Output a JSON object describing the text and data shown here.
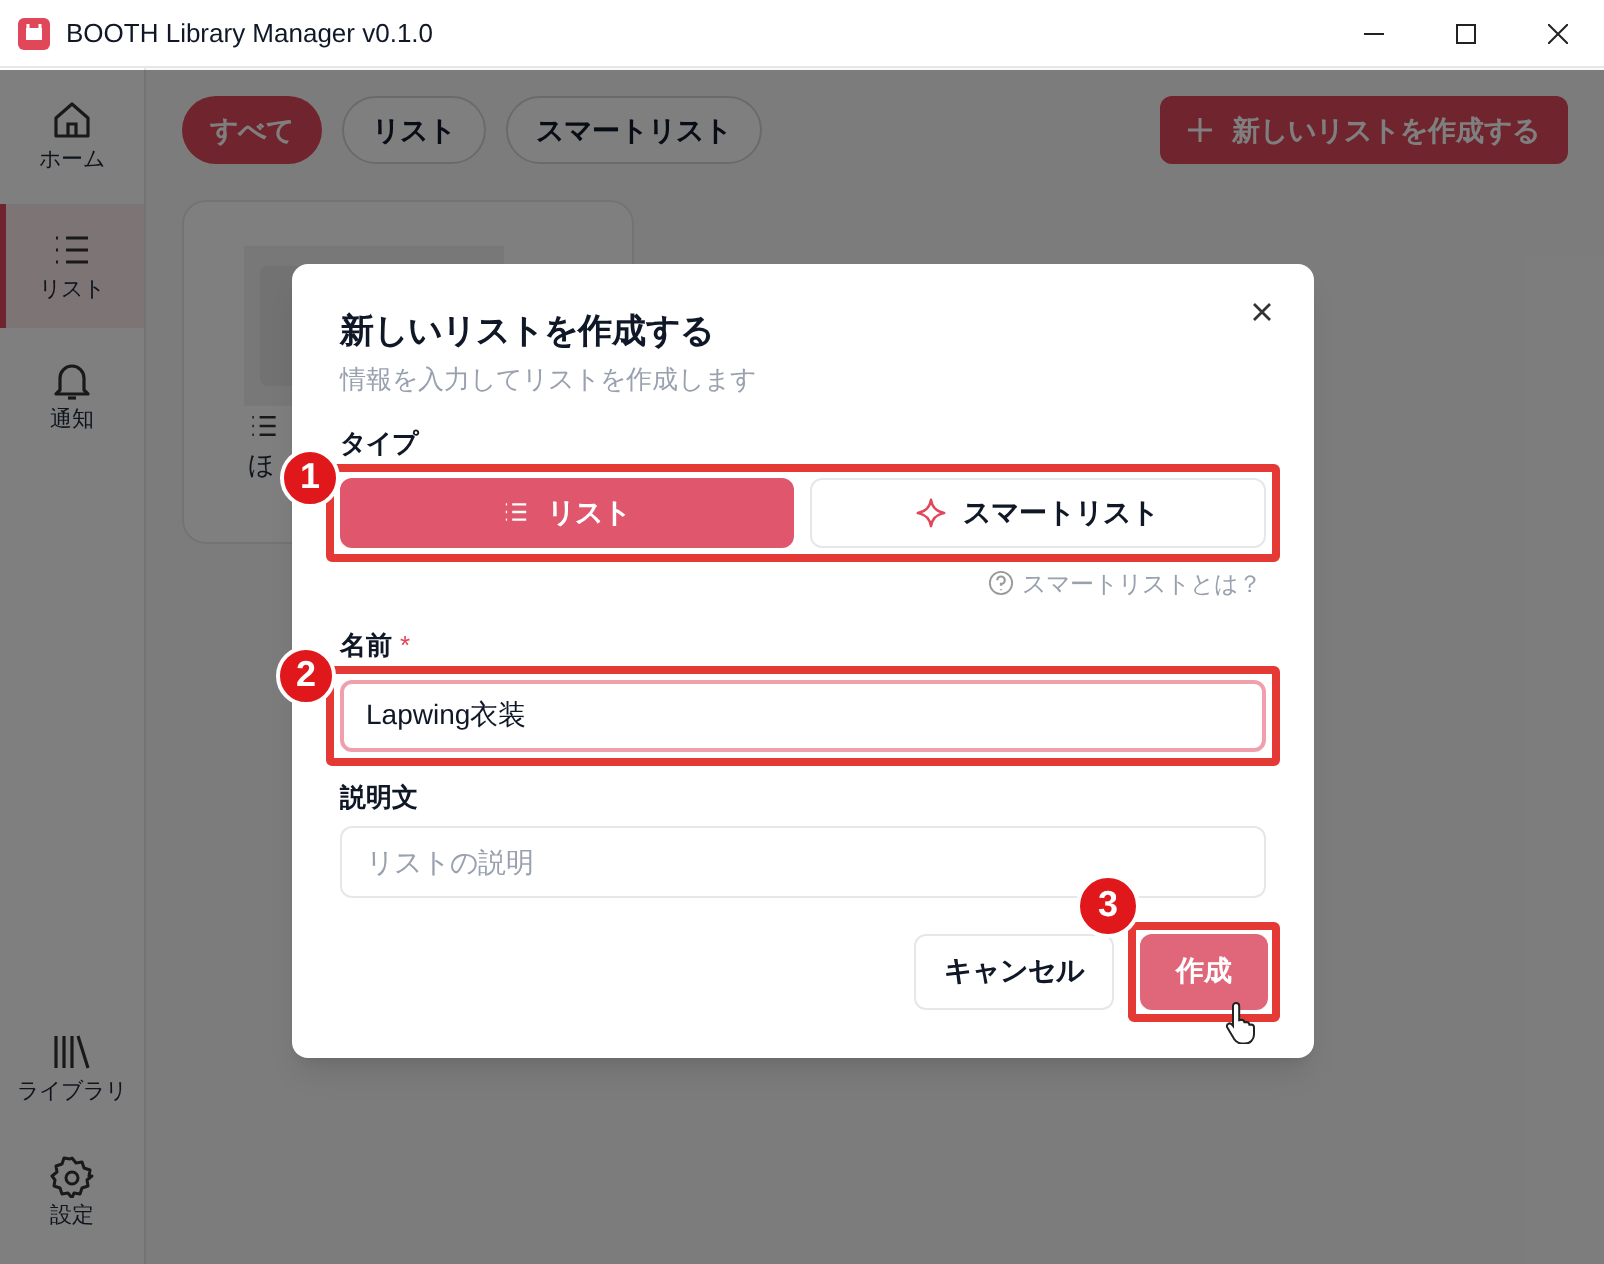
{
  "window": {
    "title": "BOOTH Library Manager v0.1.0"
  },
  "sidebar": {
    "items": [
      {
        "label": "ホーム",
        "kind": "home",
        "selected": false
      },
      {
        "label": "リスト",
        "kind": "list",
        "selected": true
      },
      {
        "label": "通知",
        "kind": "bell",
        "selected": false
      }
    ],
    "bottom_items": [
      {
        "label": "ライブラリ",
        "kind": "library",
        "selected": false
      },
      {
        "label": "設定",
        "kind": "gear",
        "selected": false
      }
    ]
  },
  "filters": [
    {
      "label": "すべて",
      "selected": true
    },
    {
      "label": "リスト",
      "selected": false
    },
    {
      "label": "スマートリスト",
      "selected": false
    }
  ],
  "create_button": {
    "label": "新しいリストを作成する"
  },
  "list_cards": [
    {
      "title": "ほ"
    }
  ],
  "dialog": {
    "title": "新しいリストを作成する",
    "subtitle": "情報を入力してリストを作成します",
    "type_label": "タイプ",
    "type_options": [
      {
        "label": "リスト",
        "kind": "list",
        "selected": true
      },
      {
        "label": "スマートリスト",
        "kind": "smart",
        "selected": false
      }
    ],
    "help_link": "スマートリストとは？",
    "name_label": "名前",
    "required_mark": "*",
    "name_value": "Lapwing衣装",
    "description_label": "説明文",
    "description_placeholder": "リストの説明",
    "buttons": [
      {
        "label": "キャンセル",
        "kind": "secondary"
      },
      {
        "label": "作成",
        "kind": "primary"
      }
    ]
  },
  "annotations": [
    "1",
    "2",
    "3"
  ]
}
